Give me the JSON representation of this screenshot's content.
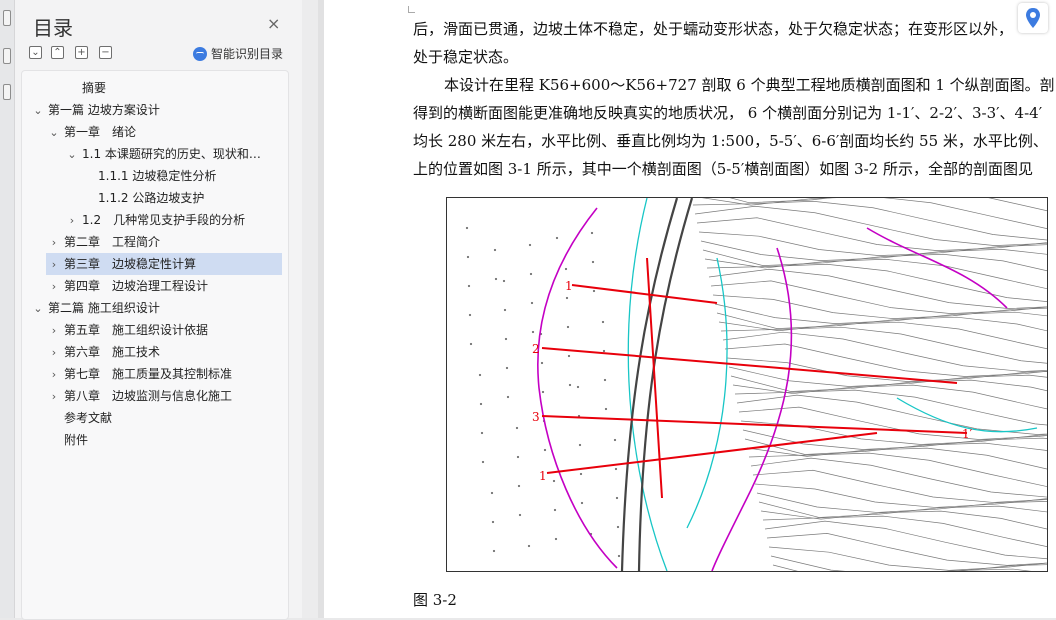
{
  "sidebar": {
    "title": "目录",
    "close_glyph": "×",
    "smart_label": "智能识别目录",
    "tools": [
      "⌄",
      "⌃",
      "+",
      "−"
    ],
    "items": [
      {
        "label": "摘要",
        "level": 2,
        "expand": ""
      },
      {
        "label": "第一篇 边坡方案设计",
        "level": 0,
        "expand": "⌄"
      },
      {
        "label": "第一章　绪论",
        "level": 1,
        "expand": "⌄"
      },
      {
        "label": "1.1 本课题研究的历史、现状和发 ...",
        "level": 2,
        "expand": "⌄"
      },
      {
        "label": "1.1.1 边坡稳定性分析",
        "level": 3,
        "expand": ""
      },
      {
        "label": "1.1.2 公路边坡支护",
        "level": 3,
        "expand": ""
      },
      {
        "label": "1.2　几种常见支护手段的分析",
        "level": 2,
        "expand": "›"
      },
      {
        "label": "第二章　工程简介",
        "level": 1,
        "expand": "›"
      },
      {
        "label": "第三章　边坡稳定性计算",
        "level": 1,
        "expand": "›",
        "selected": true
      },
      {
        "label": "第四章　边坡治理工程设计",
        "level": 1,
        "expand": "›"
      },
      {
        "label": "第二篇 施工组织设计",
        "level": 0,
        "expand": "⌄"
      },
      {
        "label": "第五章　施工组织设计依据",
        "level": 1,
        "expand": "›"
      },
      {
        "label": "第六章　施工技术",
        "level": 1,
        "expand": "›"
      },
      {
        "label": "第七章　施工质量及其控制标准",
        "level": 1,
        "expand": "›"
      },
      {
        "label": "第八章　边坡监测与信息化施工",
        "level": 1,
        "expand": "›"
      },
      {
        "label": "参考文献",
        "level": 1,
        "expand": ""
      },
      {
        "label": "附件",
        "level": 1,
        "expand": ""
      }
    ]
  },
  "document": {
    "lines": [
      "后，滑面已贯通，边坡土体不稳定，处于蠕动变形状态，处于欠稳定状态；在变形区以外，",
      "处于稳定状态。",
      "本设计在里程 K56+600～K56+727 剖取 6 个典型工程地质横剖面图和 1 个纵剖面图。剖",
      "得到的横断面图能更准确地反映真实的地质状况， 6 个横剖面分别记为 1-1′、2-2′、3-3′、4-4′",
      "均长 280 米左右，水平比例、垂直比例均为 1:500，5-5′、6-6′剖面均长约 55 米，水平比例、",
      "上的位置如图 3-1 所示，其中一个横剖面图（5-5′横剖面图）如图 3-2 所示，全部的剖面图见"
    ],
    "caption": "图 3-2",
    "figure_labels": [
      "1",
      "2",
      "3",
      "1",
      "1′"
    ]
  },
  "icons": {
    "close": "close-icon",
    "smart": "smart-toc-icon",
    "locate": "map-pin-icon"
  },
  "colors": {
    "selected_bg": "#cfdcf2",
    "accent": "#3c7be0",
    "section_red": "#e8000b",
    "contour_magenta": "#c400c4",
    "contour_cyan": "#18c6c6"
  }
}
